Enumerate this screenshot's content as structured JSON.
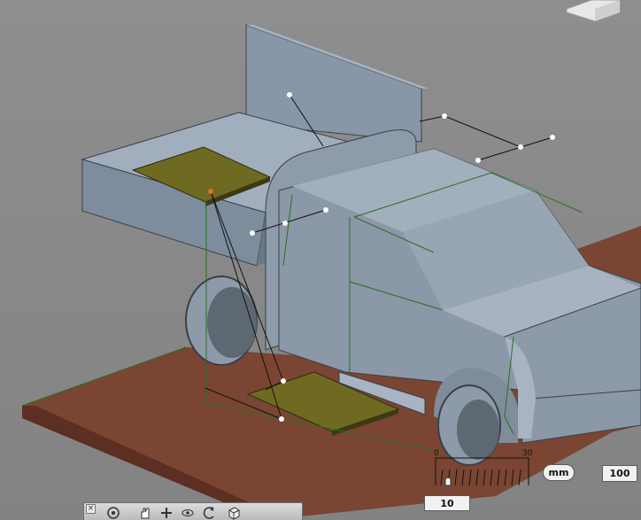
{
  "scene": {
    "description_free": true
  },
  "measure": {
    "ruler_start": "0",
    "ruler_end": "30",
    "unit": "mm",
    "length_value": "100",
    "step_value": "10"
  },
  "toolbar": {
    "close": "×",
    "tools": [
      "orbit-icon",
      "pan-icon",
      "zoom-icon",
      "look-icon",
      "rewind-icon",
      "view-cube-icon"
    ]
  },
  "colors": {
    "background": "#8a8a8a",
    "body": "#8e9cab",
    "board": "#7a4533",
    "pad": "#6f6a22",
    "sketch_line": "#2c6e1e"
  }
}
